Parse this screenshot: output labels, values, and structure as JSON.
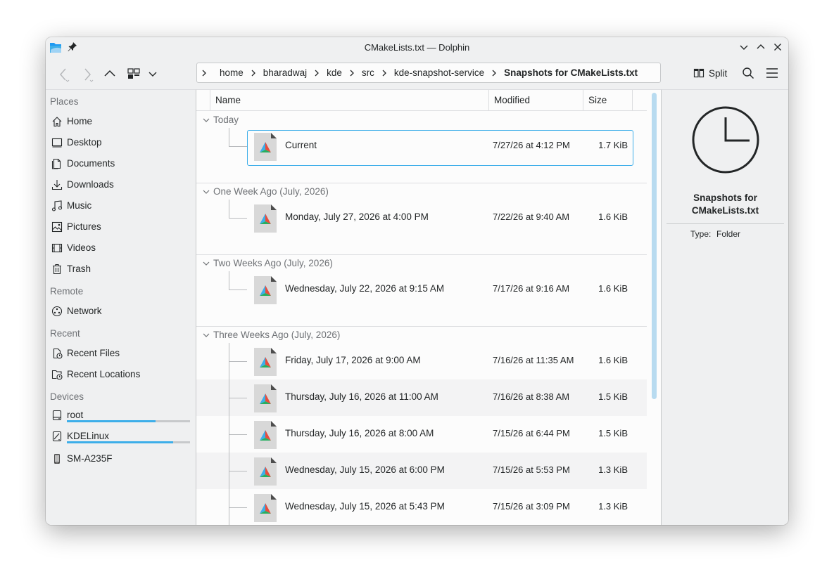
{
  "window": {
    "title": "CMakeLists.txt — Dolphin"
  },
  "toolbar": {
    "split_label": "Split"
  },
  "breadcrumb": {
    "crumbs": [
      "home",
      "bharadwaj",
      "kde",
      "src",
      "kde-snapshot-service",
      "Snapshots for CMakeLists.txt"
    ]
  },
  "places": {
    "sections": [
      {
        "header": "Places",
        "items": [
          {
            "label": "Home",
            "icon": "home-icon"
          },
          {
            "label": "Desktop",
            "icon": "desktop-icon"
          },
          {
            "label": "Documents",
            "icon": "documents-icon"
          },
          {
            "label": "Downloads",
            "icon": "downloads-icon"
          },
          {
            "label": "Music",
            "icon": "music-icon"
          },
          {
            "label": "Pictures",
            "icon": "pictures-icon"
          },
          {
            "label": "Videos",
            "icon": "videos-icon"
          },
          {
            "label": "Trash",
            "icon": "trash-icon"
          }
        ]
      },
      {
        "header": "Remote",
        "items": [
          {
            "label": "Network",
            "icon": "network-icon"
          }
        ]
      },
      {
        "header": "Recent",
        "items": [
          {
            "label": "Recent Files",
            "icon": "recent-files-icon"
          },
          {
            "label": "Recent Locations",
            "icon": "recent-locations-icon"
          }
        ]
      },
      {
        "header": "Devices",
        "items": [
          {
            "label": "root",
            "icon": "drive-icon",
            "usage": 0.72
          },
          {
            "label": "KDELinux",
            "icon": "drive-icon",
            "usage": 0.86
          },
          {
            "label": "SM-A235F",
            "icon": "phone-icon"
          }
        ]
      }
    ]
  },
  "columns": {
    "name": "Name",
    "modified": "Modified",
    "size": "Size"
  },
  "groups": [
    {
      "title": "Today",
      "rows": [
        {
          "name": "Current",
          "modified": "7/27/26 at 4:12 PM",
          "size": "1.7 KiB",
          "selected": true
        }
      ]
    },
    {
      "title": "One Week Ago (July, 2026)",
      "rows": [
        {
          "name": "Monday, July 27, 2026 at 4:00 PM",
          "modified": "7/22/26 at 9:40 AM",
          "size": "1.6 KiB"
        }
      ]
    },
    {
      "title": "Two Weeks Ago (July, 2026)",
      "rows": [
        {
          "name": "Wednesday, July 22, 2026 at 9:15 AM",
          "modified": "7/17/26 at 9:16 AM",
          "size": "1.6 KiB"
        }
      ]
    },
    {
      "title": "Three Weeks Ago (July, 2026)",
      "rows": [
        {
          "name": "Friday, July 17, 2026 at 9:00 AM",
          "modified": "7/16/26 at 11:35 AM",
          "size": "1.6 KiB"
        },
        {
          "name": "Thursday, July 16, 2026 at 11:00 AM",
          "modified": "7/16/26 at 8:38 AM",
          "size": "1.5 KiB"
        },
        {
          "name": "Thursday, July 16, 2026 at 8:00 AM",
          "modified": "7/15/26 at 6:44 PM",
          "size": "1.5 KiB"
        },
        {
          "name": "Wednesday, July 15, 2026 at 6:00 PM",
          "modified": "7/15/26 at 5:53 PM",
          "size": "1.3 KiB"
        },
        {
          "name": "Wednesday, July 15, 2026 at 5:43 PM",
          "modified": "7/15/26 at 3:09 PM",
          "size": "1.3 KiB"
        }
      ]
    }
  ],
  "info_panel": {
    "name": "Snapshots for CMakeLists.txt",
    "type_label": "Type:",
    "type_value": "Folder"
  },
  "colors": {
    "accent": "#3daee9",
    "window_bg": "#eff0f1",
    "view_bg": "#fcfcfc"
  }
}
